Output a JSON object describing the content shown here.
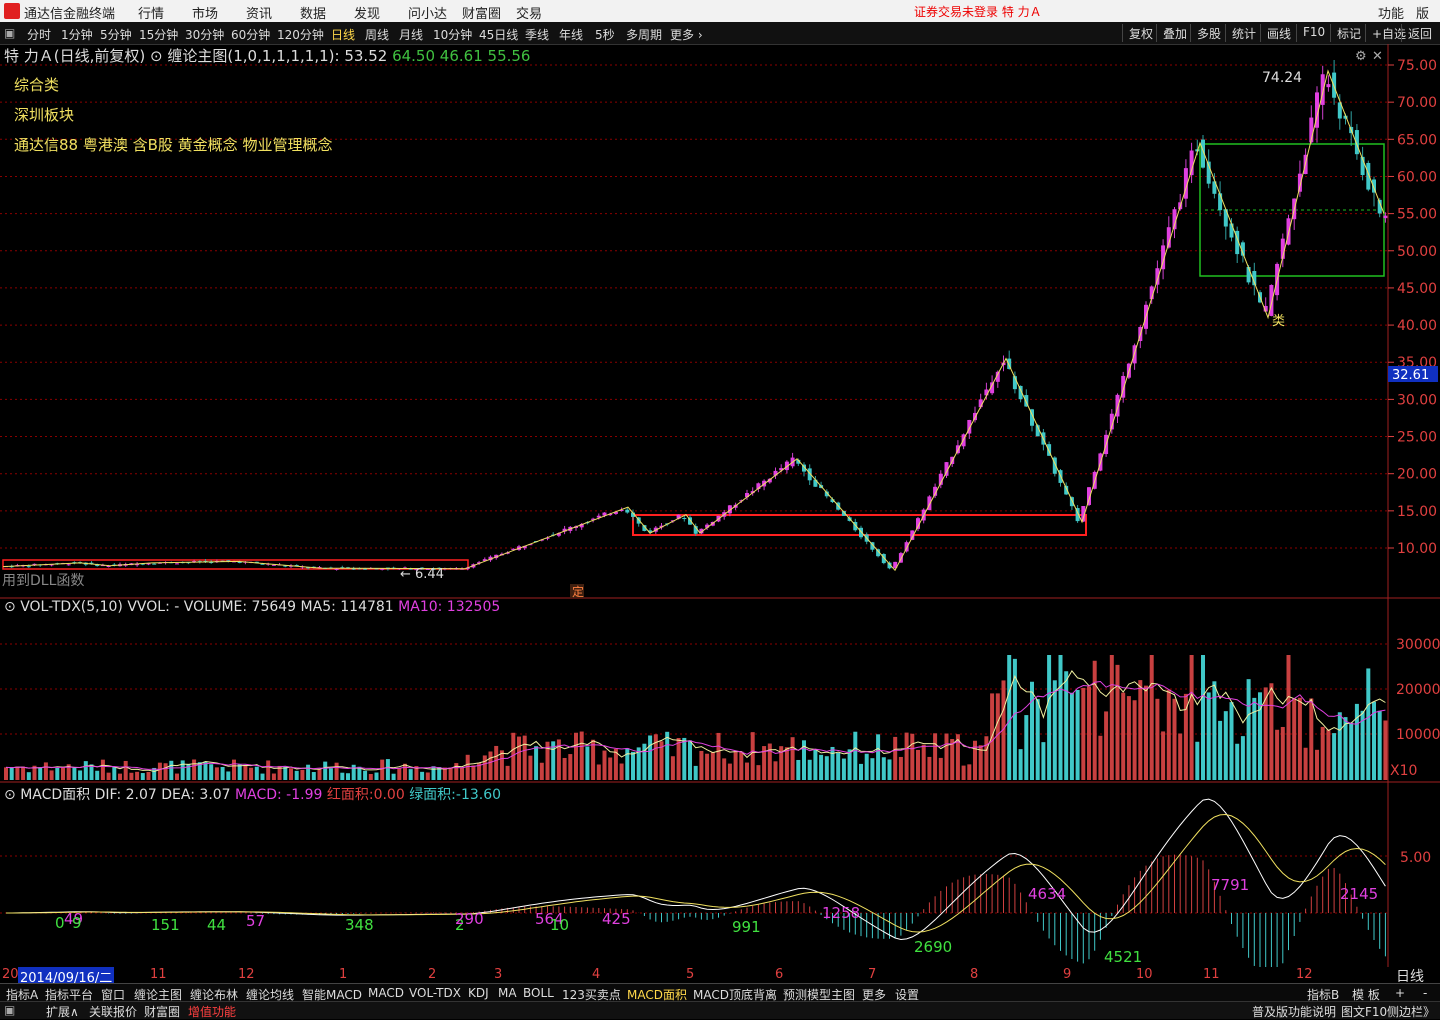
{
  "app": {
    "title": "通达信金融终端",
    "warning": "证券交易未登录",
    "stock_name": "特 力Ａ",
    "right_menu": [
      "功能",
      "版面"
    ]
  },
  "menu": [
    "行情",
    "市场",
    "资讯",
    "数据",
    "发现",
    "问小达",
    "财富圈",
    "交易"
  ],
  "periods": [
    "分时",
    "1分钟",
    "5分钟",
    "15分钟",
    "30分钟",
    "60分钟",
    "120分钟",
    "日线",
    "周线",
    "月线",
    "10分钟",
    "45日线",
    "季线",
    "年线",
    "5秒",
    "多周期",
    "更多"
  ],
  "selected_period": "日线",
  "toolbar_right": [
    "复权",
    "叠加",
    "多股",
    "统计",
    "画线",
    "F10",
    "标记",
    "+自选",
    "返回"
  ],
  "main_header": {
    "name": "特 力Ａ(日线,前复权)",
    "indicator": "缠论主图(1,0,1,1,1,1,1)",
    "v1": ": 53.52",
    "v2": "64.50",
    "v3": "46.61",
    "v4": "55.56"
  },
  "info": {
    "sector": "综合类",
    "board": "深圳板块",
    "concepts": "通达信88 粤港澳 含B股 黄金概念 物业管理概念"
  },
  "dll_note": "用到DLL函数",
  "ding_mark": "定",
  "labels": {
    "high": "74.24",
    "low": "6.44",
    "lei": "类"
  },
  "price_axis": [
    "75.00",
    "70.00",
    "65.00",
    "60.00",
    "55.00",
    "50.00",
    "45.00",
    "40.00",
    "35.00",
    "30.00",
    "25.00",
    "20.00",
    "15.00",
    "10.00"
  ],
  "current_price": "32.61",
  "vol_header": {
    "name": "VOL-TDX(5,10)",
    "vvol": "VVOL: -",
    "volume": "VOLUME: 75649",
    "ma5": "MA5: 114781",
    "ma10": "MA10: 132505"
  },
  "vol_axis": [
    "30000",
    "20000",
    "10000"
  ],
  "vol_unit": "X10",
  "macd_header": {
    "name": "MACD面积",
    "dif": "DIF: 2.07",
    "dea": "DEA: 3.07",
    "macd": "MACD: -1.99",
    "red_label": "红面积:",
    "red_val": "0.00",
    "green_label": "绿面积:",
    "green_val": "-13.60"
  },
  "macd_axis": "5.00",
  "macd_numbers": [
    {
      "t": "0",
      "c": "#40e040"
    },
    {
      "t": "49",
      "c": "#e040e0"
    },
    {
      "t": "9",
      "c": "#40e040"
    },
    {
      "t": "151",
      "c": "#40e040"
    },
    {
      "t": "44",
      "c": "#40e040"
    },
    {
      "t": "57",
      "c": "#e040e0"
    },
    {
      "t": "348",
      "c": "#40e040"
    },
    {
      "t": "2",
      "c": "#40e040"
    },
    {
      "t": "290",
      "c": "#e040e0"
    },
    {
      "t": "564",
      "c": "#e040e0"
    },
    {
      "t": "10",
      "c": "#40e040"
    },
    {
      "t": "425",
      "c": "#e040e0"
    },
    {
      "t": "991",
      "c": "#40e040"
    },
    {
      "t": "1258",
      "c": "#e040e0"
    },
    {
      "t": "2690",
      "c": "#40e040"
    },
    {
      "t": "4634",
      "c": "#e040e0"
    },
    {
      "t": "4521",
      "c": "#40e040"
    },
    {
      "t": "7791",
      "c": "#e040e0"
    },
    {
      "t": "2145",
      "c": "#e040e0"
    }
  ],
  "date_axis": {
    "first": "20",
    "cursor": "2014/09/16/二",
    "months": [
      "11",
      "12",
      "1",
      "2",
      "3",
      "4",
      "5",
      "6",
      "7",
      "8",
      "9",
      "10",
      "11",
      "12"
    ],
    "period": "日线"
  },
  "bottom_tabs": [
    "指标A",
    "指标平台",
    "窗口",
    "缠论主图",
    "缠论布林",
    "缠论均线",
    "智能MACD",
    "MACD",
    "VOL-TDX",
    "KDJ",
    "MA",
    "BOLL",
    "123买卖点",
    "MACD面积",
    "MACD顶底背离",
    "预测模型主图",
    "更多",
    "设置"
  ],
  "selected_tab": "MACD面积",
  "bottom_right": [
    "指标B",
    "模 板",
    "+",
    "-"
  ],
  "status": [
    "扩展∧",
    "关联报价",
    "财富圈",
    "增值功能"
  ],
  "status_right": [
    "普及版功能说明",
    "图文F10",
    "侧边栏》"
  ],
  "colors": {
    "up": "#e040e0",
    "down": "#40c8c8",
    "vol_up": "#c84040",
    "grid": "#8b0000",
    "axis": "#e04040",
    "yellow": "#f0e060",
    "box": "#ff2020",
    "zs": "#20c020"
  },
  "chart_data": {
    "type": "candlestick",
    "series": [
      {
        "name": "close",
        "x_months": [
          "10",
          "11",
          "12",
          "1",
          "2",
          "3",
          "4",
          "5",
          "6",
          "7",
          "8",
          "9",
          "10",
          "11",
          "12"
        ],
        "values": [
          7.5,
          8.0,
          7.9,
          7.5,
          7.2,
          9.5,
          14.5,
          13.0,
          21.0,
          7.0,
          34.0,
          13.5,
          45.0,
          64.5,
          42.0,
          74.24,
          55.6
        ]
      }
    ],
    "labeled_high": 74.24,
    "labeled_low": 6.44,
    "ylim": [
      5,
      76
    ]
  }
}
